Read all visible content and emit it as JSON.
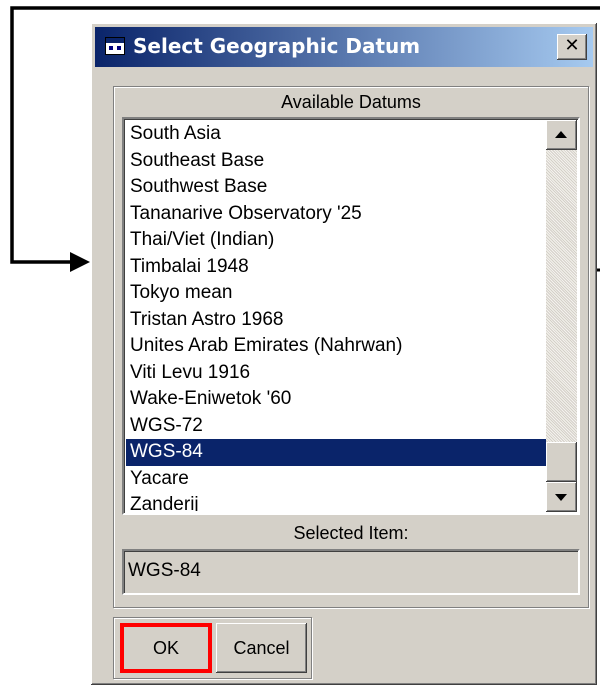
{
  "window": {
    "title": "Select Geographic Datum",
    "close_glyph": "✕"
  },
  "list": {
    "header": "Available Datums",
    "items": [
      "South Asia",
      "Southeast Base",
      "Southwest Base",
      "Tananarive Observatory '25",
      "Thai/Viet (Indian)",
      "Timbalai 1948",
      "Tokyo mean",
      "Tristan Astro 1968",
      "Unites Arab Emirates (Nahrwan)",
      "Viti Levu 1916",
      "Wake-Eniwetok '60",
      "WGS-72",
      "WGS-84",
      "Yacare",
      "Zanderij"
    ],
    "selected_index": 12
  },
  "selected": {
    "label": "Selected Item:",
    "value": "WGS-84"
  },
  "buttons": {
    "ok": "OK",
    "cancel": "Cancel"
  },
  "colors": {
    "highlight": "#0a246a",
    "ok_outline": "#ff0000"
  },
  "icons": [
    "app-icon",
    "close-icon",
    "scroll-up-arrow-icon",
    "scroll-down-arrow-icon"
  ]
}
